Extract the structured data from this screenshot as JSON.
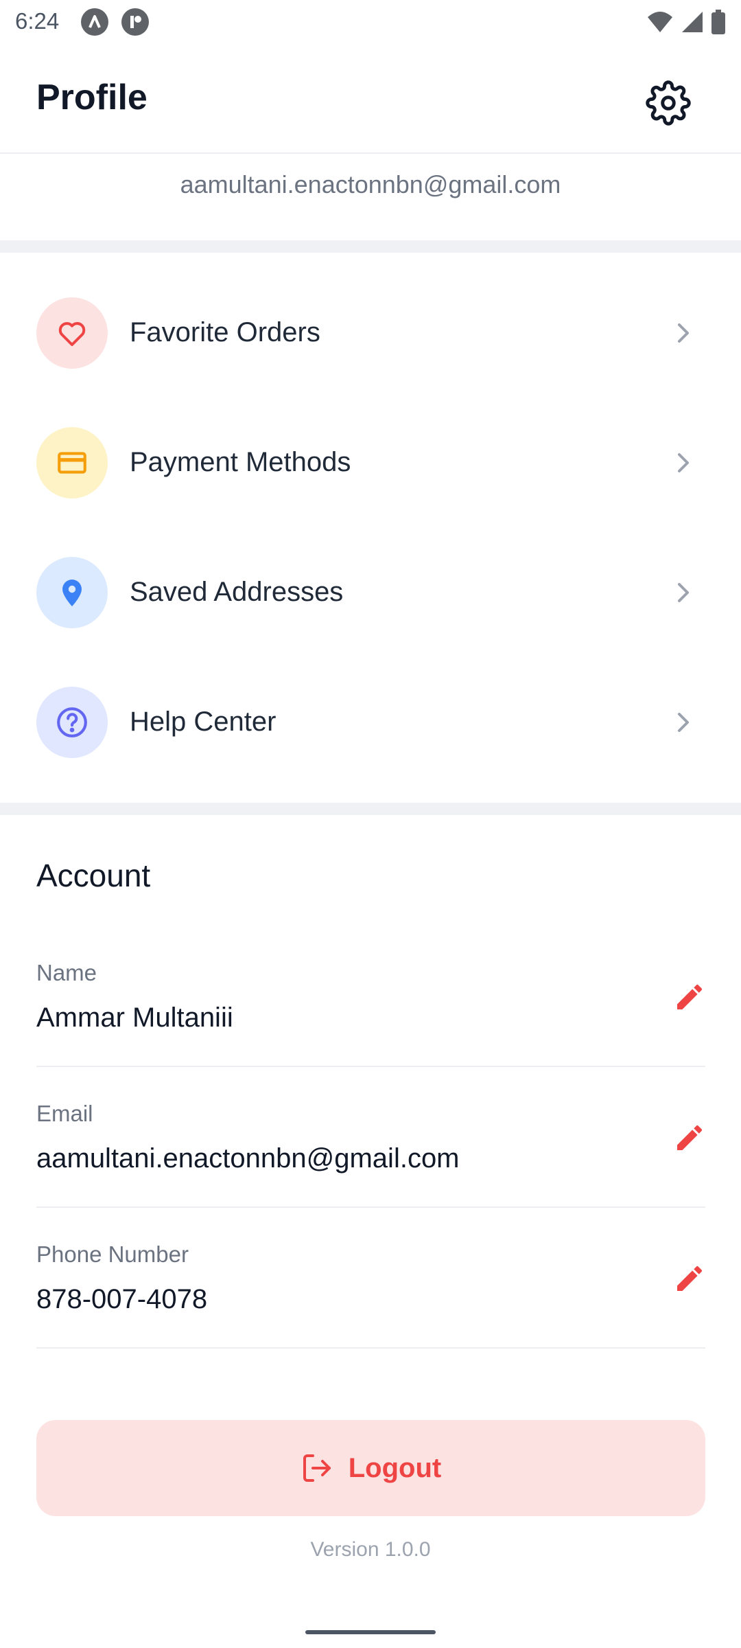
{
  "status_bar": {
    "time": "6:24"
  },
  "header": {
    "title": "Profile"
  },
  "user": {
    "email_display": "aamultani.enactonnbn@gmail.com"
  },
  "menu": [
    {
      "label": "Favorite Orders",
      "icon": "heart-icon",
      "color": "#ef4444",
      "bg": "#fde2e2"
    },
    {
      "label": "Payment Methods",
      "icon": "credit-card-icon",
      "color": "#f59e0b",
      "bg": "#fef3c7"
    },
    {
      "label": "Saved Addresses",
      "icon": "location-pin-icon",
      "color": "#3b82f6",
      "bg": "#dbeafe"
    },
    {
      "label": "Help Center",
      "icon": "help-circle-icon",
      "color": "#6366f1",
      "bg": "#e0e7ff"
    }
  ],
  "account": {
    "title": "Account",
    "fields": [
      {
        "label": "Name",
        "value": "Ammar Multaniii"
      },
      {
        "label": "Email",
        "value": "aamultani.enactonnbn@gmail.com"
      },
      {
        "label": "Phone Number",
        "value": "878-007-4078"
      }
    ]
  },
  "logout": {
    "label": "Logout"
  },
  "footer": {
    "version": "Version 1.0.0"
  },
  "colors": {
    "accent": "#ef4444",
    "divider": "#f0f1f4",
    "text_muted": "#6b7280"
  }
}
